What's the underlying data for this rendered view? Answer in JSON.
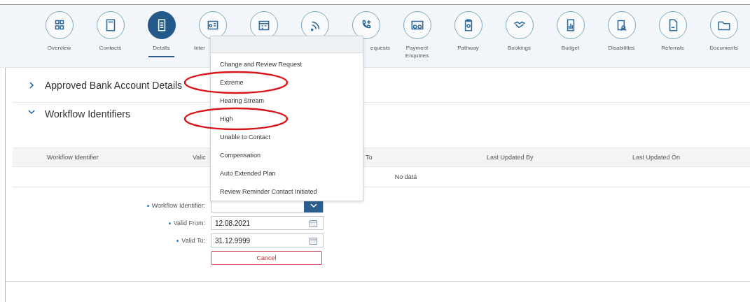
{
  "nav": [
    {
      "label": "Overview",
      "selected": false
    },
    {
      "label": "Contacts",
      "selected": false
    },
    {
      "label": "Details",
      "selected": true
    },
    {
      "label": "Inter",
      "selected": false
    },
    {
      "selected": false
    },
    {
      "selected": false
    },
    {
      "label": "equests",
      "selected": false
    },
    {
      "label": "Payment Enquiries",
      "selected": false
    },
    {
      "label": "Pathway",
      "selected": false
    },
    {
      "label": "Bookings",
      "selected": false
    },
    {
      "label": "Budget",
      "selected": false
    },
    {
      "label": "Disabilities",
      "selected": false
    },
    {
      "label": "Referrals",
      "selected": false
    },
    {
      "label": "Documents",
      "selected": false
    }
  ],
  "sections": [
    {
      "title": "Approved Bank Account Details",
      "expanded": false
    },
    {
      "title": "Workflow Identifiers",
      "expanded": true
    }
  ],
  "table": {
    "columns": [
      "Workflow Identifier",
      "Valic",
      "To",
      "Last Updated By",
      "Last Updated On"
    ],
    "empty_text": "No data"
  },
  "form": {
    "fields": [
      {
        "label": "Workflow Identifier:",
        "kind": "select",
        "required": true
      },
      {
        "label": "Valid From:",
        "kind": "date",
        "value": "12.08.2021",
        "required": true
      },
      {
        "label": "Valid To:",
        "kind": "date",
        "value": "31.12.9999",
        "required": true
      }
    ],
    "cancel": "Cancel"
  },
  "dropdown": {
    "items": [
      {
        "label": "Change and Review Request",
        "circled": false
      },
      {
        "label": "Extreme",
        "circled": true
      },
      {
        "label": "Hearing Stream",
        "circled": false
      },
      {
        "label": "High",
        "circled": true
      },
      {
        "label": "Unable to Contact",
        "circled": false
      },
      {
        "label": "Compensation",
        "circled": false
      },
      {
        "label": "Auto Extended Plan",
        "circled": false
      },
      {
        "label": "Review Reminder Contact Initiated",
        "circled": false
      }
    ]
  }
}
